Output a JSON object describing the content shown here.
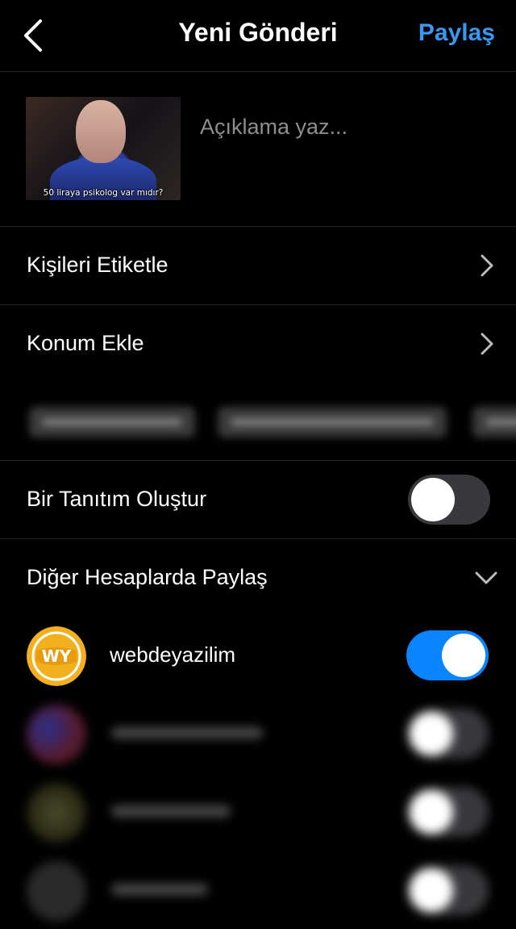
{
  "header": {
    "title": "Yeni Gönderi",
    "share_label": "Paylaş"
  },
  "compose": {
    "caption_placeholder": "Açıklama yaz...",
    "caption_value": "",
    "thumbnail_subtitle": "50 liraya psikolog var mıdır?"
  },
  "options": {
    "tag_people": "Kişileri Etiketle",
    "add_location": "Konum Ekle",
    "create_promotion": "Bir Tanıtım Oluştur",
    "create_promotion_enabled": false
  },
  "share_other": {
    "title": "Diğer Hesaplarda Paylaş",
    "expanded": true,
    "accounts": [
      {
        "name": "webdeyazilim",
        "enabled": true,
        "avatar_initials": "WY"
      },
      {
        "name": "",
        "enabled": false,
        "blurred": true
      },
      {
        "name": "",
        "enabled": false,
        "blurred": true
      },
      {
        "name": "",
        "enabled": false,
        "blurred": true
      }
    ]
  },
  "colors": {
    "accent": "#3897f0",
    "toggle_on": "#0a84ff",
    "toggle_off": "#39393d",
    "background": "#000000",
    "avatar_brand": "#f2b01e"
  },
  "icons": {
    "back": "chevron-left-icon",
    "row_disclosure": "chevron-right-icon",
    "section_expand": "chevron-down-icon"
  }
}
